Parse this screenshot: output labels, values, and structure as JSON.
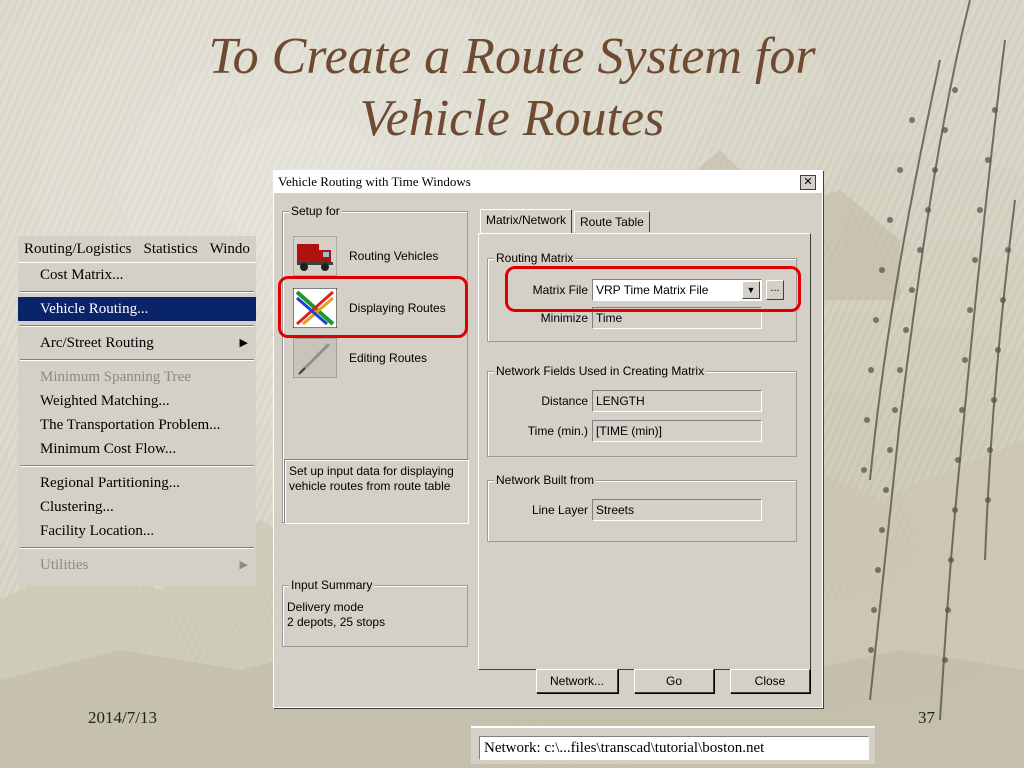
{
  "slide": {
    "title_line1": "To Create a Route System for",
    "title_line2": "Vehicle Routes",
    "date": "2014/7/13",
    "page_number": "37"
  },
  "menu": {
    "menubar": [
      "Routing/Logistics",
      "Statistics",
      "Windo"
    ],
    "items": [
      {
        "label": "Cost Matrix...",
        "state": "normal"
      },
      {
        "label": "Vehicle Routing...",
        "state": "selected"
      },
      {
        "label": "Arc/Street Routing",
        "state": "normal",
        "submenu": true
      },
      {
        "label": "Minimum Spanning Tree",
        "state": "disabled"
      },
      {
        "label": "Weighted Matching...",
        "state": "normal"
      },
      {
        "label": "The Transportation Problem...",
        "state": "normal"
      },
      {
        "label": "Minimum Cost Flow...",
        "state": "normal"
      },
      {
        "label": "Regional Partitioning...",
        "state": "normal"
      },
      {
        "label": "Clustering...",
        "state": "normal"
      },
      {
        "label": "Facility Location...",
        "state": "normal"
      },
      {
        "label": "Utilities",
        "state": "disabled",
        "submenu": true
      }
    ],
    "submenu_arrow": "▶"
  },
  "dialog": {
    "title": "Vehicle Routing with Time Windows",
    "close_glyph": "✕",
    "setup": {
      "group_label": "Setup for",
      "items": [
        {
          "label": "Routing Vehicles",
          "icon": "truck-icon"
        },
        {
          "label": "Displaying Routes",
          "icon": "routes-icon"
        },
        {
          "label": "Editing Routes",
          "icon": "pen-icon"
        }
      ],
      "description": "Set up input data for displaying vehicle routes from route table"
    },
    "input_summary": {
      "group_label": "Input Summary",
      "line1": "Delivery mode",
      "line2": "2 depots, 25 stops"
    },
    "tabs": [
      "Matrix/Network",
      "Route Table"
    ],
    "routing_matrix": {
      "group_label": "Routing Matrix",
      "matrix_file_label": "Matrix File",
      "matrix_file_value": "VRP Time Matrix File",
      "browse_label": "...",
      "minimize_label": "Minimize",
      "minimize_value": "Time"
    },
    "network_fields": {
      "group_label": "Network Fields Used in Creating Matrix",
      "distance_label": "Distance",
      "distance_value": "LENGTH",
      "time_label": "Time (min.)",
      "time_value": "[TIME (min)]"
    },
    "network_built": {
      "group_label": "Network Built from",
      "line_layer_label": "Line Layer",
      "line_layer_value": "Streets"
    },
    "buttons": {
      "network": "Network...",
      "go": "Go",
      "close": "Close"
    }
  },
  "statusbar": {
    "text": "Network: c:\\...files\\transcad\\tutorial\\boston.net"
  },
  "colors": {
    "title": "#6e4a32",
    "highlight": "#e00000",
    "menu_selected": "#0a246a",
    "dialog_bg": "#d4d0c8"
  }
}
